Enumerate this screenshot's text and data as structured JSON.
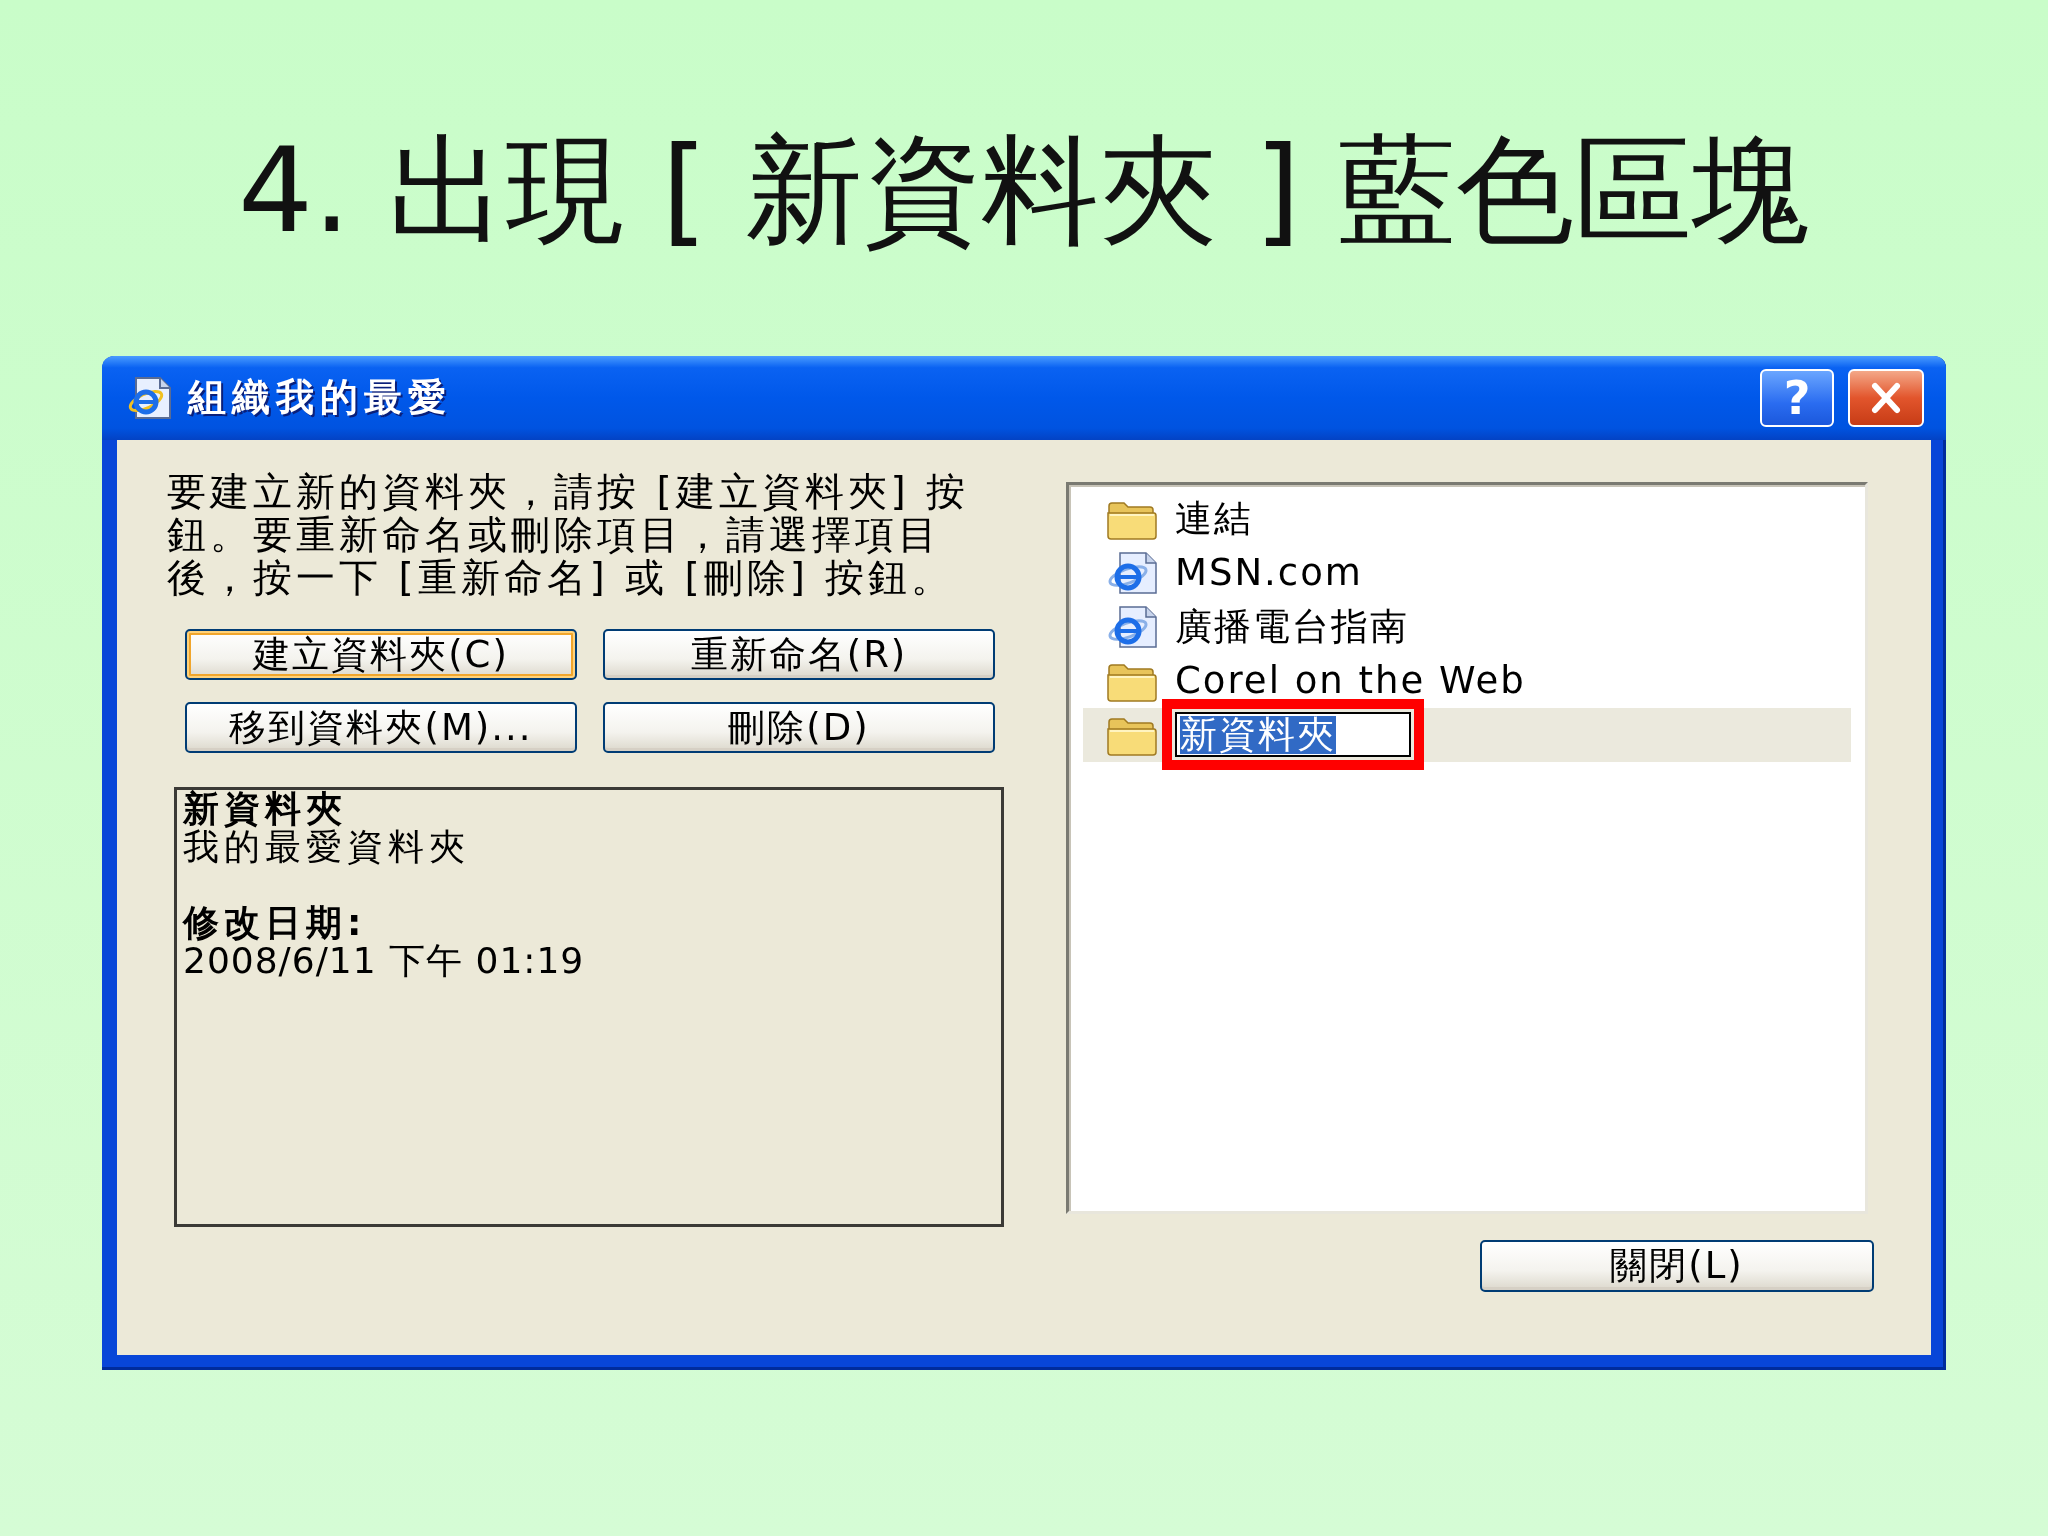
{
  "slide_title": "4. 出現 [ 新資料夾 ] 藍色區塊",
  "dialog": {
    "title": "組織我的最愛",
    "help_button": "?",
    "instructions": "要建立新的資料夾，請按 [建立資料夾] 按鈕。要重新命名或刪除項目，請選擇項目後，按一下 [重新命名] 或 [刪除] 按鈕。",
    "buttons": [
      {
        "label": "建立資料夾(C)",
        "focused": true
      },
      {
        "label": "重新命名(R)",
        "focused": false
      },
      {
        "label": "移到資料夾(M)...",
        "focused": false
      },
      {
        "label": "刪除(D)",
        "focused": false
      }
    ],
    "details": {
      "name": "新資料夾",
      "type": "我的最愛資料夾",
      "modified_label": "修改日期:",
      "modified": "2008/6/11 下午 01:19"
    },
    "favorites": [
      {
        "label": "連結",
        "kind": "folder",
        "selected": false,
        "editing": false,
        "annotated": false
      },
      {
        "label": "MSN.com",
        "kind": "link",
        "selected": false,
        "editing": false,
        "annotated": false
      },
      {
        "label": "廣播電台指南",
        "kind": "link",
        "selected": false,
        "editing": false,
        "annotated": false
      },
      {
        "label": "Corel on the Web",
        "kind": "folder",
        "selected": false,
        "editing": false,
        "annotated": false
      },
      {
        "label": "新資料夾",
        "kind": "folder",
        "selected": true,
        "editing": true,
        "annotated": true
      }
    ],
    "close_button": "關閉(L)"
  }
}
